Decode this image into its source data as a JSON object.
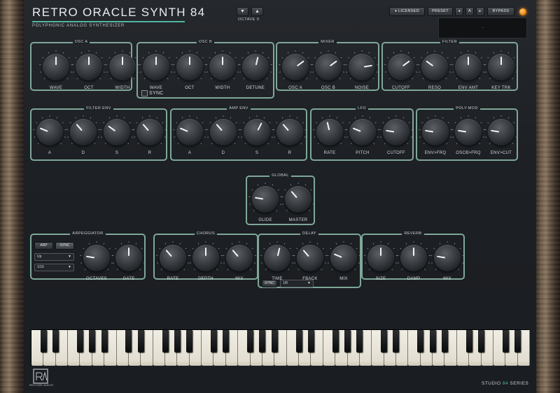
{
  "header": {
    "title": "RETRO ORACLE SYNTH 84",
    "subtitle": "POLYPHONIC ANALOG SYNTHESIZER",
    "octave_down_icon": "triangle-down-icon",
    "octave_up_icon": "triangle-up-icon",
    "octave_label": "OCTAVE 0",
    "licensed_label": "♦ LICENSED",
    "preset_label": "PRESET",
    "prev_label": "◂",
    "a_label": "A",
    "next_label": "▸",
    "bypass_label": "BYPASS",
    "display_text": "-",
    "led_color": "#f08a10"
  },
  "accent_color": "#4fb6a2",
  "sections": {
    "osc_a": {
      "title": "OSC A",
      "knobs": [
        {
          "label": "WAVE",
          "value": 0.5
        },
        {
          "label": "OCT",
          "value": 0.5
        },
        {
          "label": "WIDTH",
          "value": 0.5
        }
      ]
    },
    "osc_b": {
      "title": "OSC B",
      "sync_label": "SYNC",
      "knobs": [
        {
          "label": "WAVE",
          "value": 0.5
        },
        {
          "label": "OCT",
          "value": 0.5
        },
        {
          "label": "WIDTH",
          "value": 0.5
        },
        {
          "label": "DETUNE",
          "value": 0.55
        }
      ]
    },
    "mixer": {
      "title": "MIXER",
      "knobs": [
        {
          "label": "OSC A",
          "value": 0.7
        },
        {
          "label": "OSC B",
          "value": 0.7
        },
        {
          "label": "NOISE",
          "value": 0.8
        }
      ]
    },
    "filter": {
      "title": "FILTER",
      "knobs": [
        {
          "label": "CUTOFF",
          "value": 0.7
        },
        {
          "label": "RESO",
          "value": 0.3
        },
        {
          "label": "ENV AMT",
          "value": 0.5
        },
        {
          "label": "KEY TRK",
          "value": 0.5
        }
      ]
    },
    "filter_env": {
      "title": "FILTER ENV",
      "knobs": [
        {
          "label": "A",
          "value": 0.25
        },
        {
          "label": "D",
          "value": 0.35
        },
        {
          "label": "S",
          "value": 0.3
        },
        {
          "label": "R",
          "value": 0.35
        }
      ]
    },
    "amp_env": {
      "title": "AMP ENV",
      "knobs": [
        {
          "label": "A",
          "value": 0.25
        },
        {
          "label": "D",
          "value": 0.35
        },
        {
          "label": "S",
          "value": 0.6
        },
        {
          "label": "R",
          "value": 0.35
        }
      ]
    },
    "lfo": {
      "title": "LFO",
      "knobs": [
        {
          "label": "RATE",
          "value": 0.45
        },
        {
          "label": "PITCH",
          "value": 0.25
        },
        {
          "label": "CUTOFF",
          "value": 0.2
        }
      ]
    },
    "poly_mod": {
      "title": "POLY-MOD",
      "knobs": [
        {
          "label": "ENV>FRQ",
          "value": 0.2
        },
        {
          "label": "OSCB>FRQ",
          "value": 0.2
        },
        {
          "label": "ENV>CUT",
          "value": 0.2
        }
      ]
    },
    "global": {
      "title": "GLOBAL",
      "knobs": [
        {
          "label": "GLIDE",
          "value": 0.2
        },
        {
          "label": "MASTER",
          "value": 0.35
        }
      ]
    },
    "arpeggiator": {
      "title": "ARPEGGIATOR",
      "arp_label": "ARP",
      "sync_label": "SYNC",
      "mode_value": "Up",
      "rate_value": "1/16",
      "knobs": [
        {
          "label": "OCTAVES",
          "value": 0.2
        },
        {
          "label": "GATE",
          "value": 0.5
        }
      ]
    },
    "chorus": {
      "title": "CHORUS",
      "knobs": [
        {
          "label": "RATE",
          "value": 0.35
        },
        {
          "label": "DEPTH",
          "value": 0.5
        },
        {
          "label": "MIX",
          "value": 0.35
        }
      ]
    },
    "delay": {
      "title": "DELAY",
      "sync_label": "SYNC",
      "time_value": "1/8",
      "knobs": [
        {
          "label": "TIME",
          "value": 0.55
        },
        {
          "label": "FBACK",
          "value": 0.35
        },
        {
          "label": "MIX",
          "value": 0.25
        }
      ]
    },
    "reverb": {
      "title": "REVERB",
      "knobs": [
        {
          "label": "SIZE",
          "value": 0.5
        },
        {
          "label": "DAMP",
          "value": 0.5
        },
        {
          "label": "MIX",
          "value": 0.2
        }
      ]
    }
  },
  "footer": {
    "logo_letters": "RA",
    "logo_text": "RECODE AUDIO",
    "series_prefix": "STUDIO",
    "series_number": "84",
    "series_suffix": "SERIES"
  }
}
